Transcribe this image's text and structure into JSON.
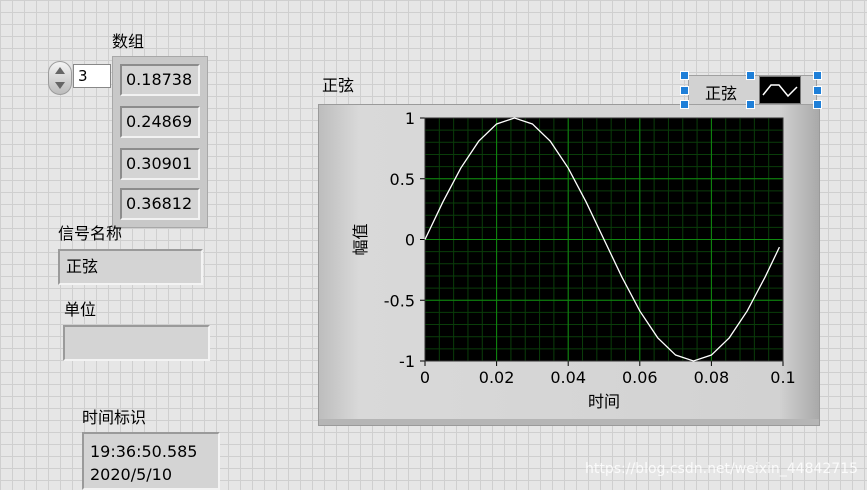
{
  "array_control": {
    "label": "数组",
    "index_value": "3",
    "elements": [
      "0.18738",
      "0.24869",
      "0.30901",
      "0.36812"
    ]
  },
  "signal_name": {
    "label": "信号名称",
    "value": "正弦"
  },
  "unit": {
    "label": "单位",
    "value": ""
  },
  "timestamp": {
    "label": "时间标识",
    "time": "19:36:50.585",
    "date": "2020/5/10"
  },
  "graph": {
    "label": "正弦",
    "legend_name": "正弦",
    "plot_bg_color": "#000000",
    "grid_major_color": "#0f8a0f",
    "grid_minor_color": "#0a3d0a",
    "trace_color": "#ffffff"
  },
  "watermark": "https://blog.csdn.net/weixin_44842715",
  "chart_data": {
    "type": "line",
    "title": "正弦",
    "xlabel": "时间",
    "ylabel": "幅值",
    "xlim": [
      0,
      0.1
    ],
    "ylim": [
      -1,
      1
    ],
    "x_ticks": [
      "0",
      "0.02",
      "0.04",
      "0.06",
      "0.08",
      "0.1"
    ],
    "y_ticks": [
      "1",
      "0.5",
      "0",
      "-0.5",
      "-1"
    ],
    "grid": true,
    "series": [
      {
        "name": "正弦",
        "x": [
          0,
          0.005,
          0.01,
          0.015,
          0.02,
          0.025,
          0.03,
          0.035,
          0.04,
          0.045,
          0.05,
          0.055,
          0.06,
          0.065,
          0.07,
          0.075,
          0.08,
          0.085,
          0.09,
          0.095,
          0.099
        ],
        "y": [
          0,
          0.309,
          0.588,
          0.809,
          0.951,
          1,
          0.951,
          0.809,
          0.588,
          0.309,
          0,
          -0.309,
          -0.588,
          -0.809,
          -0.951,
          -1,
          -0.951,
          -0.809,
          -0.588,
          -0.309,
          -0.063
        ]
      }
    ]
  }
}
